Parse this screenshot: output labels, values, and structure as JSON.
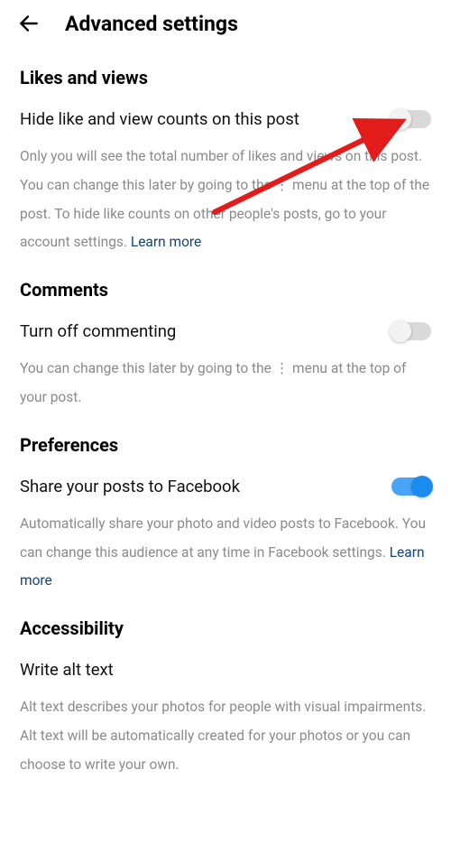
{
  "header": {
    "title": "Advanced settings"
  },
  "sections": {
    "likes": {
      "title": "Likes and views",
      "setting_label": "Hide like and view counts on this post",
      "description": "Only you will see the total number of likes and views on this post. You can change this later by going to the ⋮ menu at the top of the post. To hide like counts on other people's posts, go to your account settings. ",
      "learn_more": "Learn more"
    },
    "comments": {
      "title": "Comments",
      "setting_label": "Turn off commenting",
      "description": "You can change this later by going to the ⋮ menu at the top of your post."
    },
    "preferences": {
      "title": "Preferences",
      "setting_label": "Share your posts to Facebook",
      "description": "Automatically share your photo and video posts to Facebook. You can change this audience at any time in Facebook settings. ",
      "learn_more": "Learn more"
    },
    "accessibility": {
      "title": "Accessibility",
      "setting_label": "Write alt text",
      "description": "Alt text describes your photos for people with visual impairments. Alt text will be automatically created for your photos or you can choose to write your own."
    }
  }
}
